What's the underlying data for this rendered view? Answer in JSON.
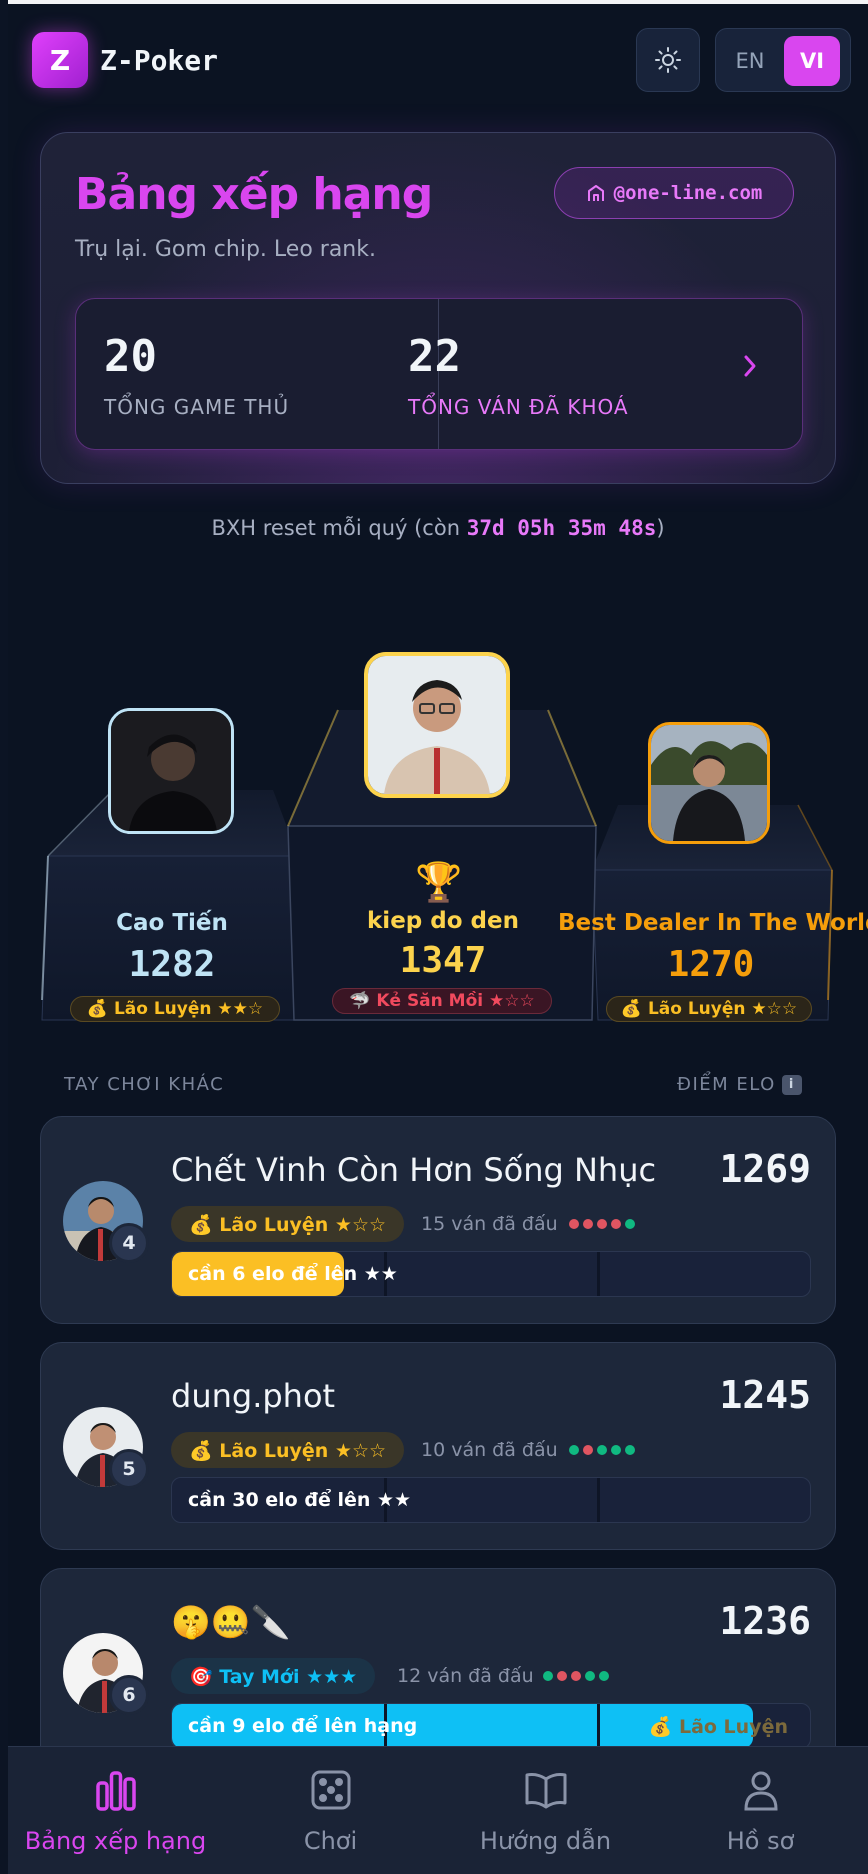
{
  "app": {
    "logo_letter": "Z",
    "title": "Z-Poker"
  },
  "header": {
    "theme_icon": "sun-icon",
    "lang_en": "EN",
    "lang_vi": "VI",
    "active_lang": "VI"
  },
  "hero": {
    "title": "Bảng xếp hạng",
    "subtitle": "Trụ lại. Gom chip. Leo rank.",
    "domain": "@one-line.com",
    "stats": [
      {
        "value": "20",
        "label": "TỔNG GAME THỦ"
      },
      {
        "value": "22",
        "label": "TỔNG VÁN ĐÃ KHOÁ"
      }
    ]
  },
  "reset": {
    "prefix": "BXH reset mỗi quý (còn ",
    "time": "37d 05h 35m 48s",
    "suffix": ")"
  },
  "podium": [
    {
      "rank": 2,
      "name": "Cao Tiến",
      "score": "1282",
      "tier": "💰 Lão Luyện ★★☆",
      "color": "#bfe3f5"
    },
    {
      "rank": 1,
      "name": "kiep do den",
      "score": "1347",
      "tier": "🦈 Kẻ Săn Mồi ★☆☆",
      "color": "#fcd34d",
      "trophy": "🏆"
    },
    {
      "rank": 3,
      "name": "Best Dealer In The World",
      "score": "1270",
      "tier": "💰 Lão Luyện ★☆☆",
      "color": "#f59e0b"
    }
  ],
  "list": {
    "left_header": "TAY CHƠI KHÁC",
    "right_header": "ĐIỂM ELO",
    "info_icon": "i",
    "rows": [
      {
        "rank": "4",
        "name": "Chết Vinh Còn Hơn Sống Nhục",
        "score": "1269",
        "tier": "💰 Lão Luyện ★☆☆",
        "games": "15 ván đã đấu",
        "form": [
          "L",
          "L",
          "L",
          "L",
          "W"
        ],
        "progress_text": "cần 6 elo để lên ★★",
        "progress": 0.27
      },
      {
        "rank": "5",
        "name": "dung.phot",
        "score": "1245",
        "tier": "💰 Lão Luyện ★☆☆",
        "games": "10 ván đã đấu",
        "form": [
          "W",
          "L",
          "W",
          "W",
          "W"
        ],
        "progress_text": "cần 30 elo để lên ★★",
        "progress": 0.0
      },
      {
        "rank": "6",
        "name": "🤫🤐🔪",
        "score": "1236",
        "tier": "🎯 Tay Mới ★★★",
        "games": "12 ván đã đấu",
        "form": [
          "W",
          "L",
          "L",
          "W",
          "W"
        ],
        "progress_text": "cần 9 elo để lên hạng",
        "next_tier": "💰 Lão Luyện",
        "progress": 0.91
      }
    ]
  },
  "nav": [
    {
      "label": "Bảng xếp hạng",
      "icon": "bar-chart-icon",
      "active": true
    },
    {
      "label": "Chơi",
      "icon": "dice-icon",
      "active": false
    },
    {
      "label": "Hướng dẫn",
      "icon": "book-icon",
      "active": false
    },
    {
      "label": "Hồ sơ",
      "icon": "user-icon",
      "active": false
    }
  ],
  "colors": {
    "accent": "#d946ef",
    "gold": "#fcd34d",
    "win": "#10b981",
    "loss": "#e05561",
    "lao_luyen": "#fbbf24",
    "tay_moi": "#0ec0f5"
  }
}
